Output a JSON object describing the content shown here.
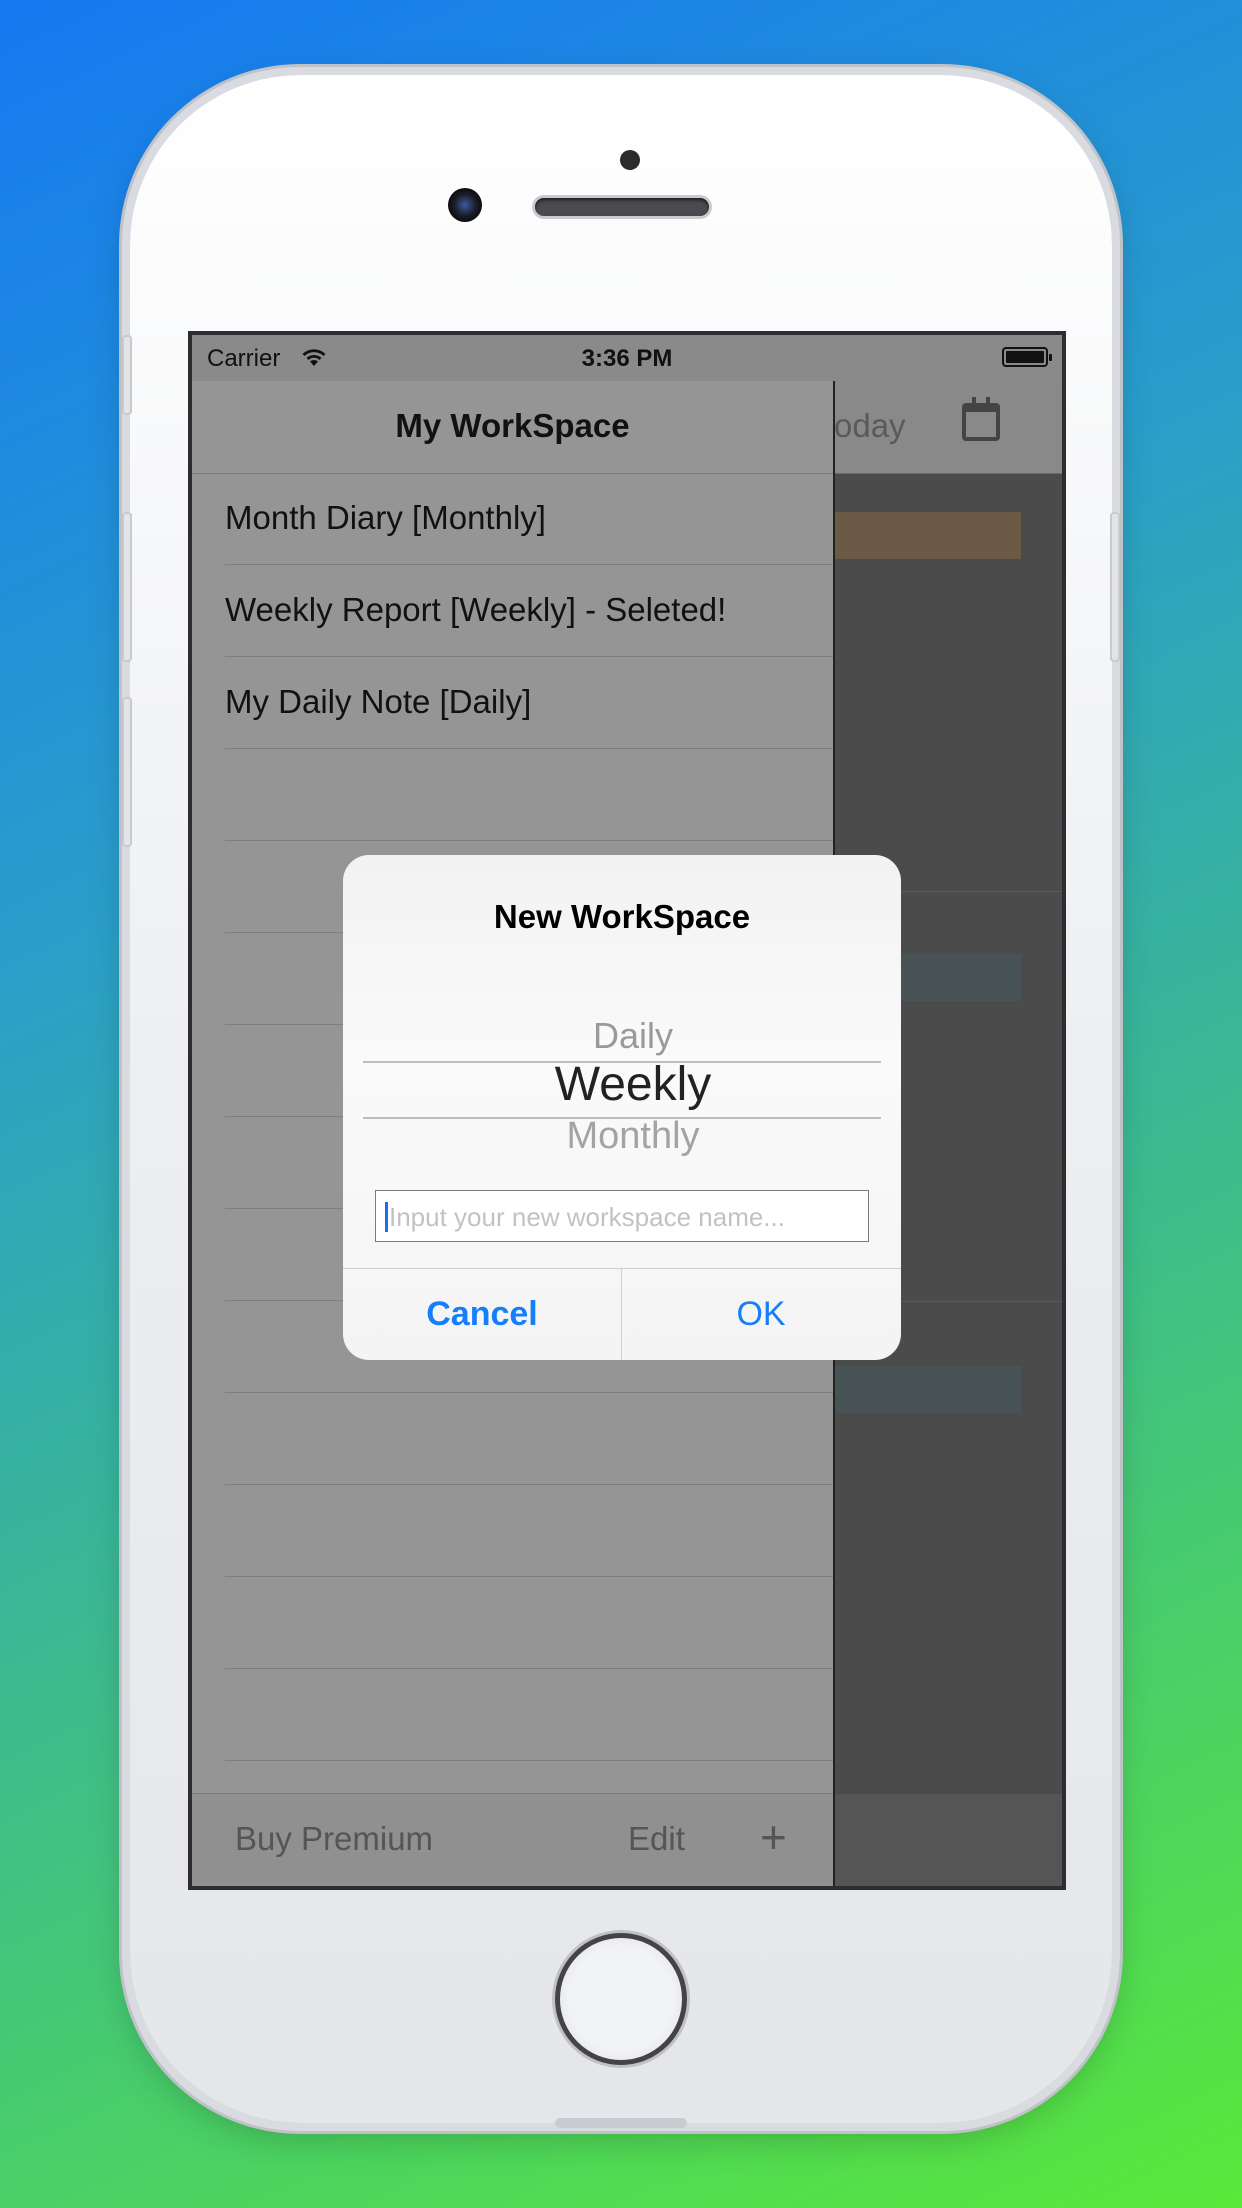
{
  "status_bar": {
    "carrier": "Carrier",
    "time": "3:36 PM"
  },
  "main": {
    "today_label": "oday"
  },
  "sidebar": {
    "title": "My WorkSpace",
    "items": [
      {
        "label": "Month Diary [Monthly]"
      },
      {
        "label": "Weekly Report [Weekly] - Seleted!"
      },
      {
        "label": "My Daily Note [Daily]"
      }
    ],
    "empty_rows": 11,
    "toolbar": {
      "buy_premium": "Buy Premium",
      "edit": "Edit",
      "add": "+"
    }
  },
  "alert": {
    "title": "New WorkSpace",
    "picker": {
      "options": [
        "Daily",
        "Weekly",
        "Monthly"
      ],
      "selected": "Weekly"
    },
    "input": {
      "value": "",
      "placeholder": "Input your new workspace name..."
    },
    "cancel_label": "Cancel",
    "ok_label": "OK"
  },
  "colors": {
    "accent": "#157efb",
    "background_gradient": [
      "#1579f2",
      "#5ae83a"
    ],
    "highlight_orange": "#6b5a45",
    "highlight_blue": "#485356"
  }
}
